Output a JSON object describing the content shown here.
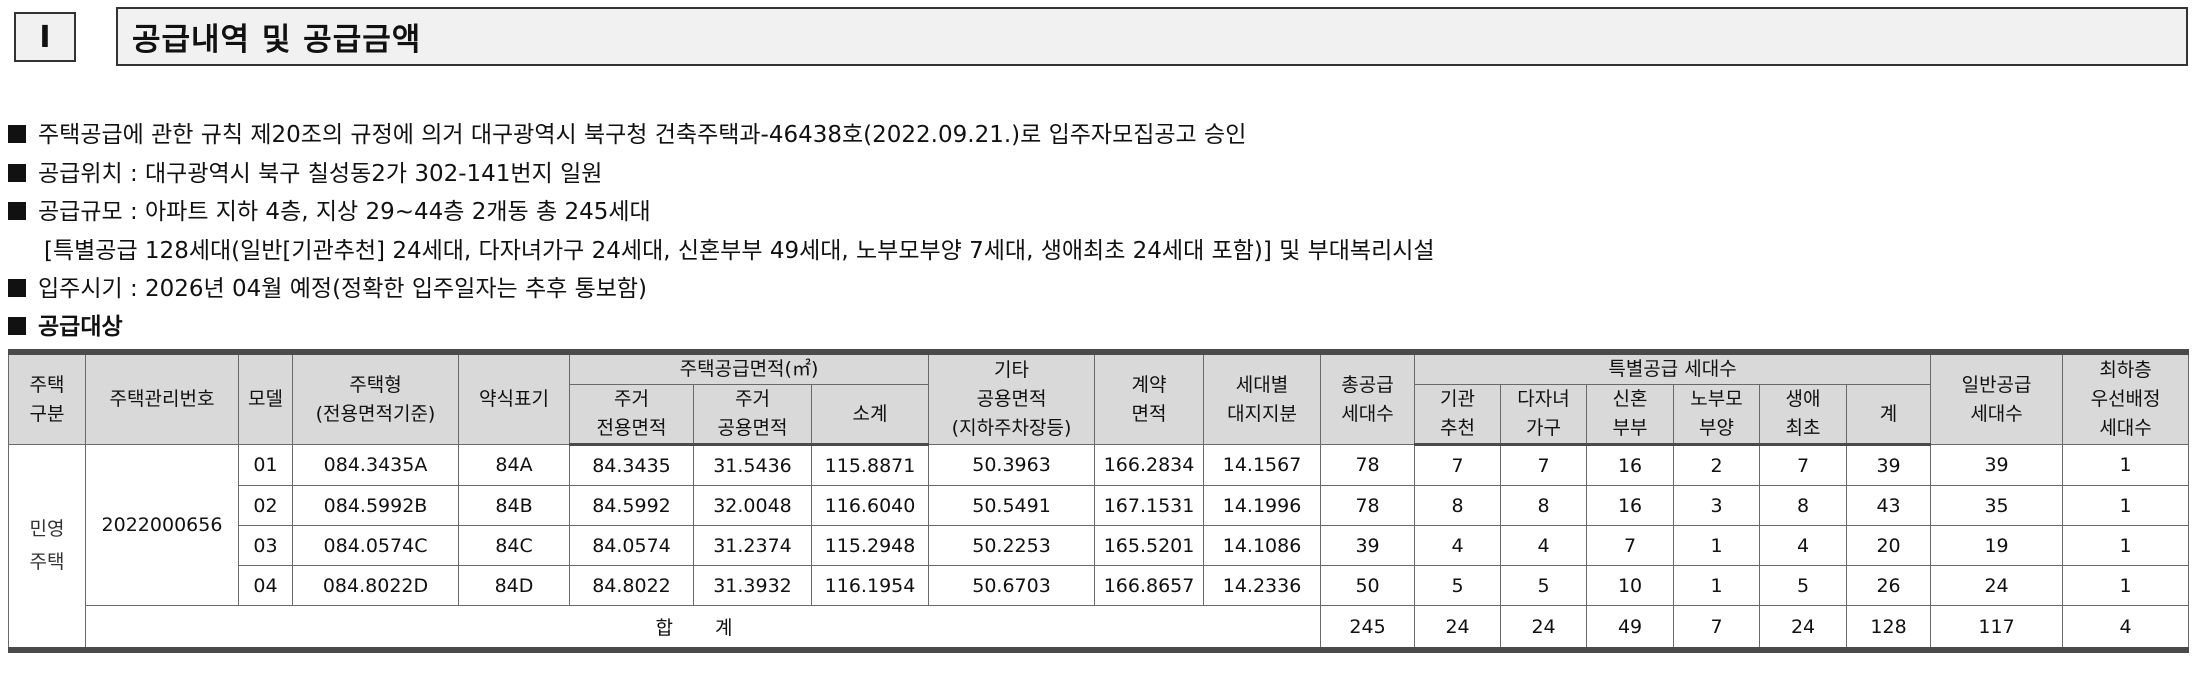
{
  "section": {
    "number": "I",
    "title": "공급내역 및 공급금액"
  },
  "lines": [
    "주택공급에 관한 규칙 제20조의 규정에 의거 대구광역시 북구청 건축주택과-46438호(2022.09.21.)로 입주자모집공고 승인",
    "공급위치 : 대구광역시 북구 칠성동2가 302-141번지 일원",
    "공급규모 : 아파트 지하 4층, 지상 29~44층 2개동 총 245세대",
    "[특별공급 128세대(일반[기관추천] 24세대, 다자녀가구 24세대, 신혼부부 49세대, 노부모부양 7세대, 생애최초 24세대 포함)] 및 부대복리시설",
    "입주시기 : 2026년 04월 예정(정확한 입주일자는 추후 통보함)",
    "공급대상"
  ],
  "table": {
    "headers": {
      "house_type_category": "주택\n구분",
      "management_no": "주택관리번호",
      "model": "모델",
      "house_type": "주택형\n(전용면적기준)",
      "short_label": "약식표기",
      "supply_area_group": "주택공급면적(㎡)",
      "exclusive_area": "주거\n전용면적",
      "common_area": "주거\n공용면적",
      "subtotal": "소계",
      "other_common": "기타\n공용면적\n(지하주차장등)",
      "contract_area": "계약\n면적",
      "land_share": "세대별\n대지지분",
      "total_supply": "총공급\n세대수",
      "special_group": "특별공급 세대수",
      "inst": "기관\n추천",
      "multi_child": "다자녀\n가구",
      "newlywed": "신혼\n부부",
      "elderly": "노부모\n부양",
      "first_time": "생애\n최초",
      "special_sum": "계",
      "general": "일반공급\n세대수",
      "lowest_floor": "최하층\n우선배정\n세대수"
    },
    "category": "민영\n주택",
    "management_no": "2022000656",
    "rows": [
      {
        "model": "01",
        "type": "084.3435A",
        "short": "84A",
        "excl": "84.3435",
        "common": "31.5436",
        "sub": "115.8871",
        "other": "50.3963",
        "contract": "166.2834",
        "land": "14.1567",
        "total": "78",
        "inst": "7",
        "multi": "7",
        "newly": "16",
        "elder": "2",
        "first": "7",
        "sp": "39",
        "gen": "39",
        "low": "1"
      },
      {
        "model": "02",
        "type": "084.5992B",
        "short": "84B",
        "excl": "84.5992",
        "common": "32.0048",
        "sub": "116.6040",
        "other": "50.5491",
        "contract": "167.1531",
        "land": "14.1996",
        "total": "78",
        "inst": "8",
        "multi": "8",
        "newly": "16",
        "elder": "3",
        "first": "8",
        "sp": "43",
        "gen": "35",
        "low": "1"
      },
      {
        "model": "03",
        "type": "084.0574C",
        "short": "84C",
        "excl": "84.0574",
        "common": "31.2374",
        "sub": "115.2948",
        "other": "50.2253",
        "contract": "165.5201",
        "land": "14.1086",
        "total": "39",
        "inst": "4",
        "multi": "4",
        "newly": "7",
        "elder": "1",
        "first": "4",
        "sp": "20",
        "gen": "19",
        "low": "1"
      },
      {
        "model": "04",
        "type": "084.8022D",
        "short": "84D",
        "excl": "84.8022",
        "common": "31.3932",
        "sub": "116.1954",
        "other": "50.6703",
        "contract": "166.8657",
        "land": "14.2336",
        "total": "50",
        "inst": "5",
        "multi": "5",
        "newly": "10",
        "elder": "1",
        "first": "5",
        "sp": "26",
        "gen": "24",
        "low": "1"
      }
    ],
    "total": {
      "label": "합 계",
      "total": "245",
      "inst": "24",
      "multi": "24",
      "newly": "49",
      "elder": "7",
      "first": "24",
      "sp": "128",
      "gen": "117",
      "low": "4"
    }
  }
}
